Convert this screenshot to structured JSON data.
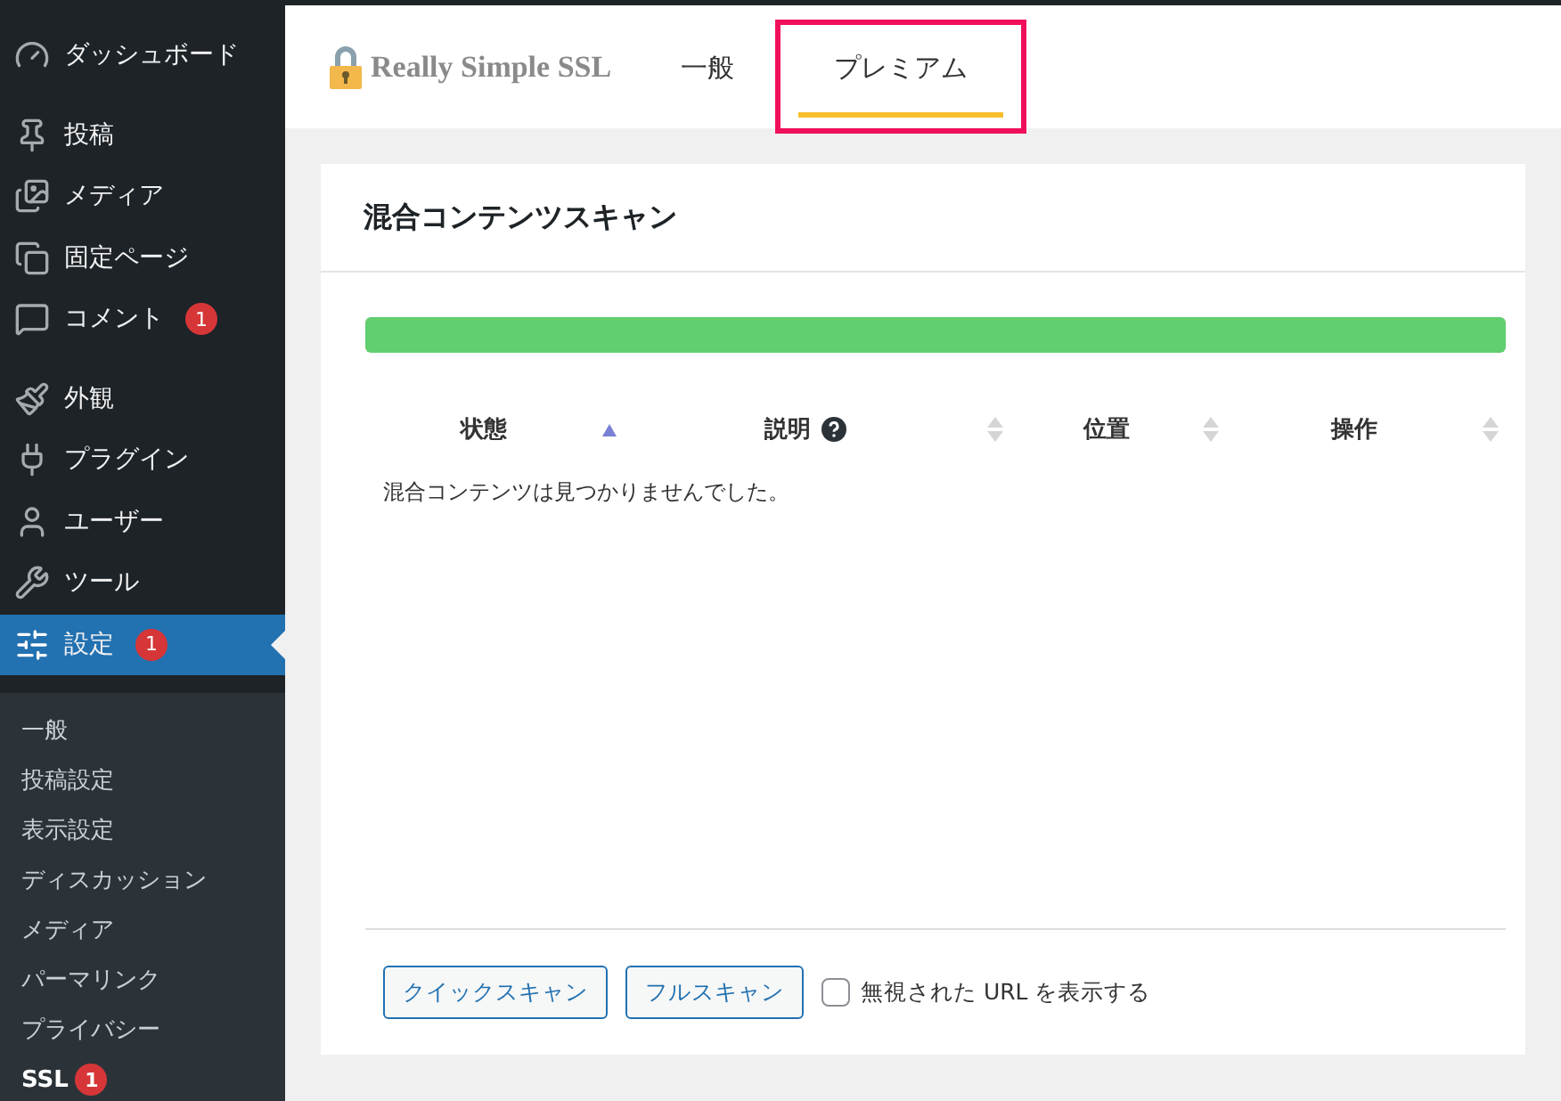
{
  "sidebar": {
    "groups": [
      [
        {
          "label": "ダッシュボード",
          "selected": false
        }
      ],
      [
        {
          "label": "投稿",
          "selected": false
        },
        {
          "label": "メディア",
          "selected": false
        },
        {
          "label": "固定ページ",
          "selected": false
        },
        {
          "label": "コメント",
          "badge": "1",
          "selected": false
        }
      ],
      [
        {
          "label": "外観",
          "selected": false
        },
        {
          "label": "プラグイン",
          "selected": false
        },
        {
          "label": "ユーザー",
          "selected": false
        },
        {
          "label": "ツール",
          "selected": false
        },
        {
          "label": "設定",
          "badge": "1",
          "selected": true
        }
      ]
    ],
    "submenu": [
      {
        "label": "一般",
        "selected": false
      },
      {
        "label": "投稿設定",
        "selected": false
      },
      {
        "label": "表示設定",
        "selected": false
      },
      {
        "label": "ディスカッション",
        "selected": false
      },
      {
        "label": "メディア",
        "selected": false
      },
      {
        "label": "パーマリンク",
        "selected": false
      },
      {
        "label": "プライバシー",
        "selected": false
      },
      {
        "label": "SSL",
        "badge": "1",
        "selected": true
      }
    ]
  },
  "header": {
    "logo": "Really Simple SSL",
    "tabs": [
      {
        "label": "一般",
        "selected": false,
        "highlighted": false
      },
      {
        "label": "プレミアム",
        "selected": true,
        "highlighted": true
      }
    ]
  },
  "card": {
    "title": "混合コンテンツスキャン",
    "progress": {
      "level": 1
    },
    "table": {
      "columns": [
        {
          "label": "状態",
          "sorted": true,
          "help": false
        },
        {
          "label": "説明",
          "sorted": false,
          "help": true
        },
        {
          "label": "位置",
          "sorted": false,
          "help": false
        },
        {
          "label": "操作",
          "sorted": false,
          "help": false
        }
      ],
      "empty_message": "混合コンテンツは見つかりませんでした。"
    },
    "buttons": [
      "クイックスキャン",
      "フルスキャン"
    ],
    "show_ignored": {
      "label": "無視された URL を表示する",
      "checked": false
    }
  }
}
